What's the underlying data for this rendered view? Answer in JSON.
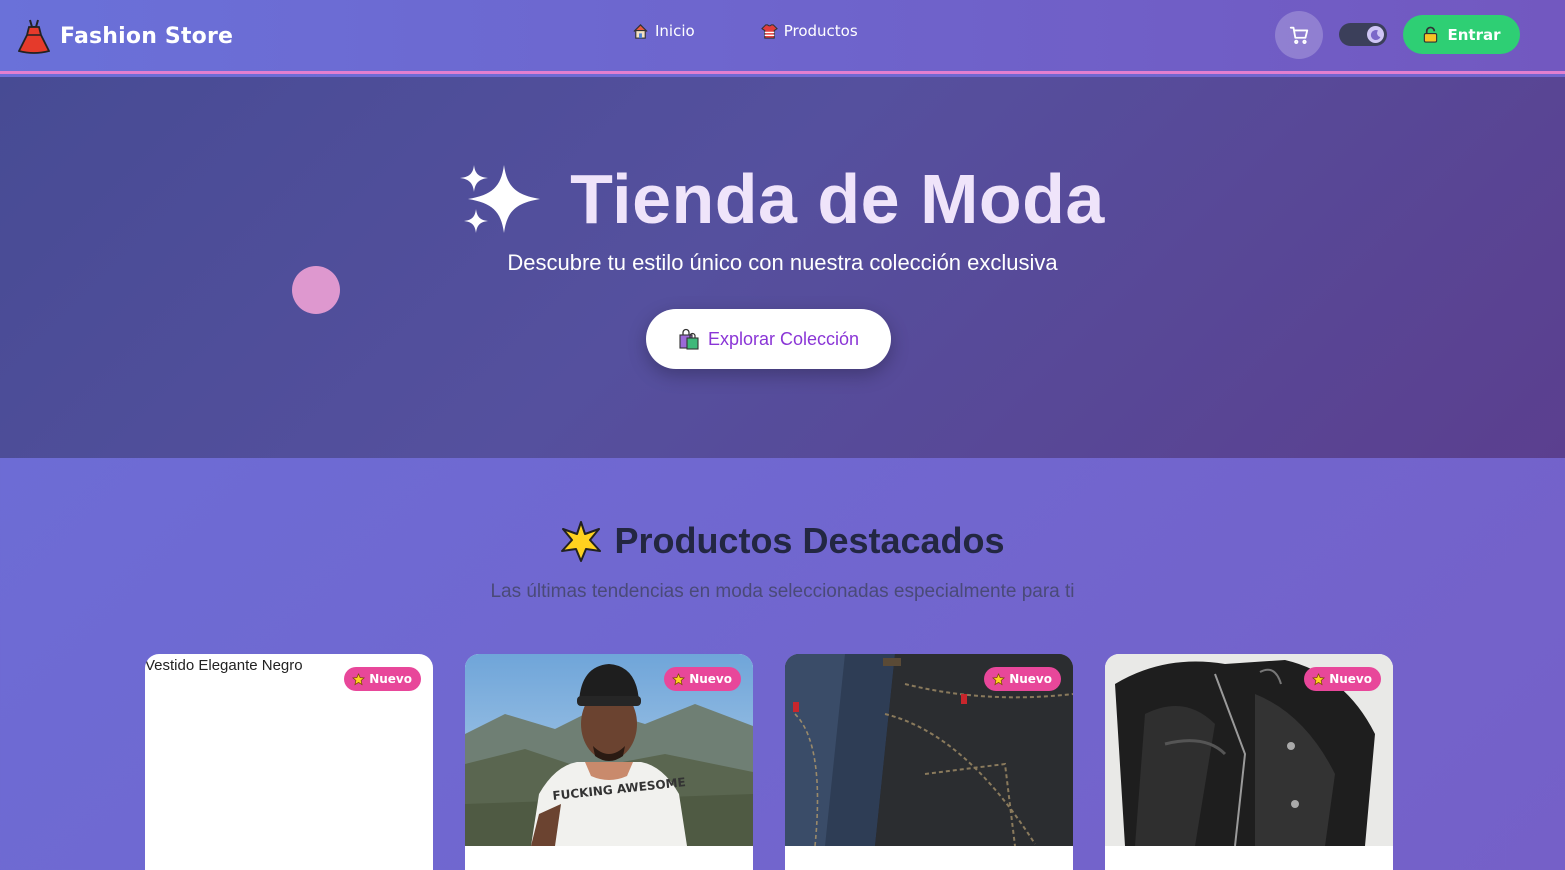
{
  "navbar": {
    "brand": "Fashion Store",
    "brand_icon": "dress-icon",
    "links": [
      {
        "label": "Inicio",
        "icon": "house-icon"
      },
      {
        "label": "Productos",
        "icon": "shirt-icon"
      }
    ],
    "cart_icon": "cart-icon",
    "theme_toggle_icon": "moon-icon",
    "login_label": "Entrar",
    "login_icon": "lock-icon"
  },
  "hero": {
    "title": "Tienda de Moda",
    "title_icon": "sparkles-icon",
    "subtitle": "Descubre tu estilo único con nuestra colección exclusiva",
    "cta_label": "Explorar Colección",
    "cta_icon": "shopping-bags-icon"
  },
  "featured": {
    "title": "Productos Destacados",
    "title_icon": "star-icon",
    "subtitle": "Las últimas tendencias en moda seleccionadas especialmente para ti",
    "products": [
      {
        "image_alt": "Vestido Elegante Negro",
        "badge": "Nuevo"
      },
      {
        "badge": "Nuevo"
      },
      {
        "badge": "Nuevo"
      },
      {
        "badge": "Nuevo"
      }
    ]
  },
  "colors": {
    "navbar_accent": "#e27fd0",
    "login_button": "#2ecf74",
    "badge": "#e8479a",
    "cta_text": "#8a35d6"
  }
}
